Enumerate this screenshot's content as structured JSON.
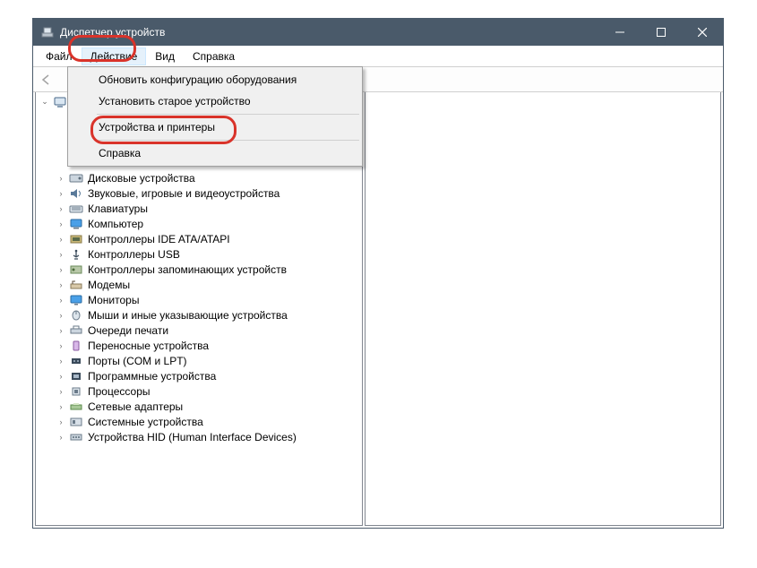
{
  "window": {
    "title": "Диспетчер устройств"
  },
  "menubar": {
    "file": "Файл",
    "action": "Действие",
    "view": "Вид",
    "help": "Справка"
  },
  "dropdown": {
    "scan": "Обновить конфигурацию оборудования",
    "legacy": "Установить старое устройство",
    "printers": "Устройства и принтеры",
    "help": "Справка"
  },
  "tree": {
    "items": [
      {
        "label": "Дисковые устройства"
      },
      {
        "label": "Звуковые, игровые и видеоустройства"
      },
      {
        "label": "Клавиатуры"
      },
      {
        "label": "Компьютер"
      },
      {
        "label": "Контроллеры IDE ATA/ATAPI"
      },
      {
        "label": "Контроллеры USB"
      },
      {
        "label": "Контроллеры запоминающих устройств"
      },
      {
        "label": "Модемы"
      },
      {
        "label": "Мониторы"
      },
      {
        "label": "Мыши и иные указывающие устройства"
      },
      {
        "label": "Очереди печати"
      },
      {
        "label": "Переносные устройства"
      },
      {
        "label": "Порты (COM и LPT)"
      },
      {
        "label": "Программные устройства"
      },
      {
        "label": "Процессоры"
      },
      {
        "label": "Сетевые адаптеры"
      },
      {
        "label": "Системные устройства"
      },
      {
        "label": "Устройства HID (Human Interface Devices)"
      }
    ]
  }
}
